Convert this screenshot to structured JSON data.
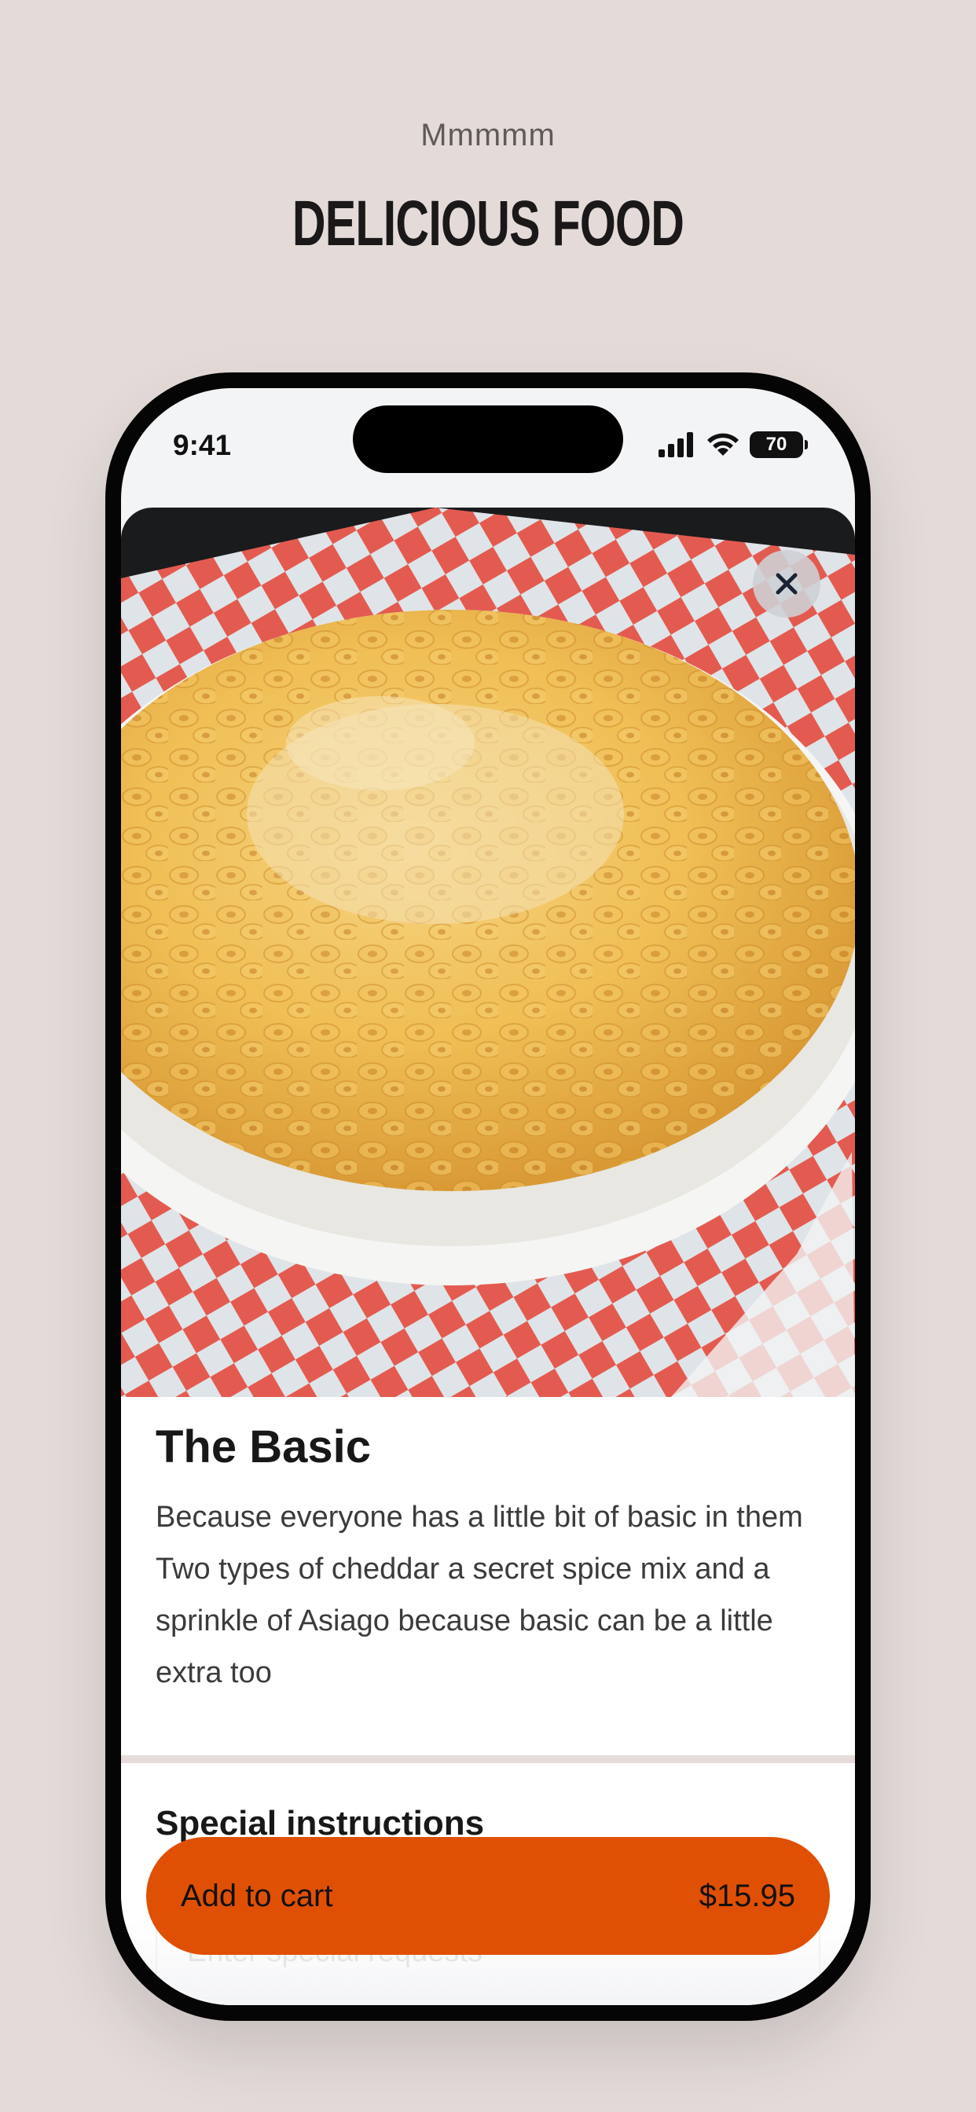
{
  "hero": {
    "kicker": "Mmmmm",
    "headline": "DELICIOUS FOOD"
  },
  "status_bar": {
    "time": "9:41",
    "battery": "70"
  },
  "item": {
    "title": "The Basic",
    "description": "Because everyone has a little bit of basic in them Two types of cheddar a secret spice mix and a sprinkle of Asiago because basic can be a little extra too",
    "photo_alt": "mac-and-cheese-bowl"
  },
  "special_instructions": {
    "heading": "Special instructions",
    "placeholder": "Enter special requests"
  },
  "cart": {
    "label": "Add to cart",
    "price": "$15.95"
  },
  "colors": {
    "background": "#e4dbd9",
    "accent": "#e05004"
  },
  "icons": {
    "close": "close-icon",
    "signal": "cellular-signal-icon",
    "wifi": "wifi-icon",
    "battery": "battery-icon"
  }
}
